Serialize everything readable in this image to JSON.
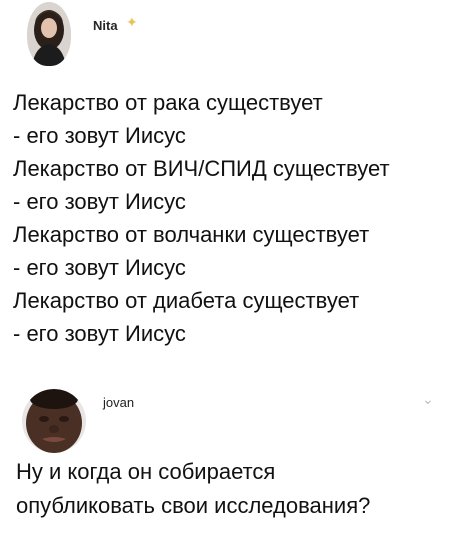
{
  "post": {
    "author": "Nita",
    "badge_icon": "sparkle-icon",
    "lines": [
      "Лекарство от рака существует",
      "- его зовут Иисус",
      "Лекарство от ВИЧ/СПИД существует",
      "- его зовут Иисус",
      "Лекарство от волчанки существует",
      "- его зовут Иисус",
      "Лекарство от диабета существует",
      "- его зовут Иисус"
    ]
  },
  "reply": {
    "author": "jovan",
    "menu_icon": "chevron-down-icon",
    "lines": [
      "Ну и когда он собирается",
      "опубликовать свои исследования?"
    ]
  },
  "colors": {
    "background": "#ffffff",
    "text": "#111111",
    "sparkle": "#e9c25a",
    "chevron": "#bdbdbd"
  }
}
